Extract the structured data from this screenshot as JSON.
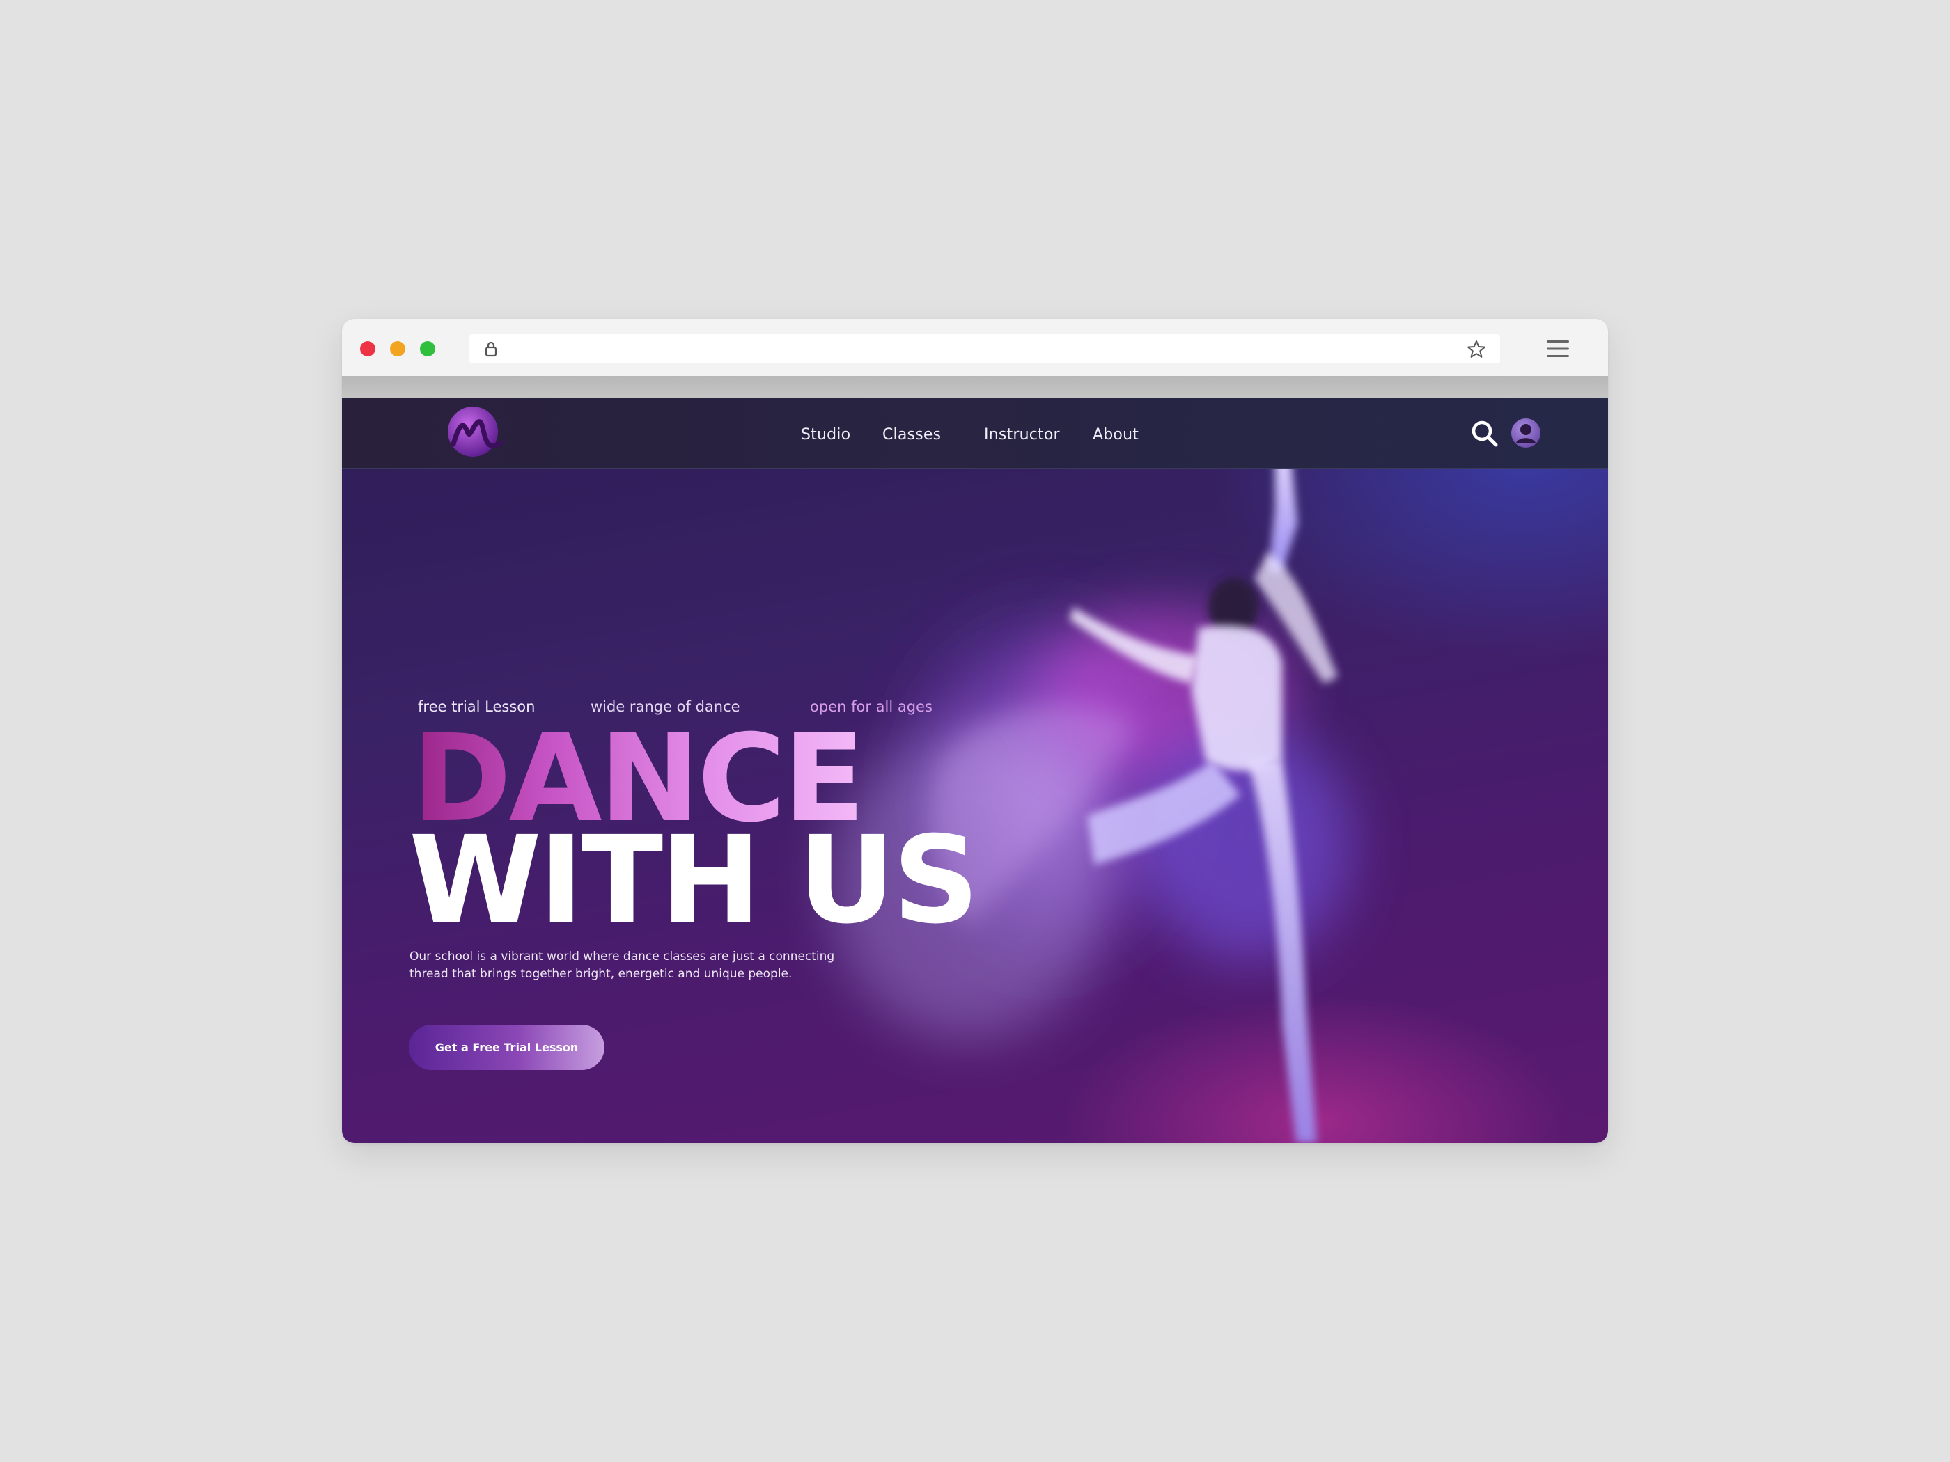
{
  "browser": {
    "address_bar": {
      "lock_icon": "lock-icon",
      "bookmark_icon": "star-icon"
    },
    "menu_icon": "hamburger-menu-icon"
  },
  "site": {
    "logo_icon": "brand-logo-m",
    "nav": {
      "items": [
        {
          "label": "Studio"
        },
        {
          "label": "Classes"
        },
        {
          "label": "Instructor"
        },
        {
          "label": "About"
        }
      ],
      "search_icon": "search-icon",
      "profile_icon": "user-avatar-icon"
    },
    "hero": {
      "taglines": [
        "free trial Lesson",
        "wide range of dance",
        "open for all ages"
      ],
      "headline_line1": "DANCE",
      "headline_line2": "WITH US",
      "description": "Our school is a vibrant world where dance classes are just a connecting thread that brings together bright, energetic and unique people.",
      "cta_label": "Get a Free Trial Lesson"
    }
  },
  "colors": {
    "page_background": "#e2e2e2",
    "navbar": "#28233f",
    "hero_dark": "#3a2266",
    "accent_pink": "#d6349f",
    "accent_violet": "#8a46b5",
    "headline_gradient_start": "#9a2487",
    "headline_gradient_end": "#f3b9f7"
  }
}
